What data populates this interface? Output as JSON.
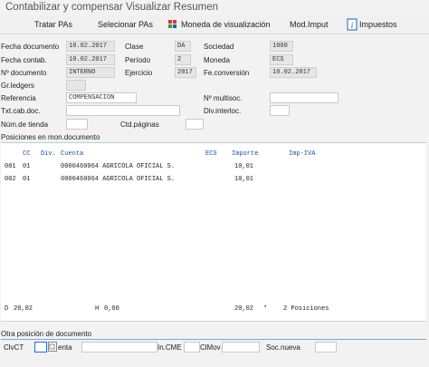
{
  "window": {
    "title": "Contabilizar y compensar Visualizar Resumen"
  },
  "toolbar": {
    "tratar": "Tratar PAs",
    "seleccionar": "Selecionar PAs",
    "moneda_vis": "Moneda de visualización",
    "mod_imput": "Mod.Imput",
    "impuestos": "Impuestos"
  },
  "header": {
    "fecha_doc_label": "Fecha documento",
    "fecha_doc": "10.02.2017",
    "clase_label": "Clase",
    "clase": "DA",
    "sociedad_label": "Sociedad",
    "sociedad": "1000",
    "fecha_contab_label": "Fecha contab.",
    "fecha_contab": "10.02.2017",
    "periodo_label": "Período",
    "periodo": "2",
    "moneda_label": "Moneda",
    "moneda": "ECS",
    "no_doc_label": "Nº documento",
    "no_doc": "INTERNO",
    "ejercicio_label": "Ejercicio",
    "ejercicio": "2017",
    "fe_conv_label": "Fe.conversión",
    "fe_conv": "10.02.2017",
    "gr_ledgers_label": "Gr.ledgers",
    "gr_ledgers": "",
    "referencia_label": "Referencia",
    "referencia": "COMPENSACION",
    "multisoc_label": "Nº multisoc.",
    "multisoc": "",
    "txt_cab_label": "Txt.cab.doc.",
    "txt_cab": "",
    "div_interloc_label": "Div.interloc.",
    "div_interloc": "",
    "num_tienda_label": "Núm.de tienda",
    "num_tienda": "",
    "ctd_paginas_label": "Ctd.páginas",
    "ctd_paginas": ""
  },
  "positions": {
    "section_title": "Posiciones en mon.documento",
    "columns": {
      "cc": "CC",
      "div": "Div.",
      "cuenta": "Cuenta",
      "ecs": "ECS",
      "importe": "Importe",
      "imp_iva": "Imp-IVA"
    },
    "rows": [
      {
        "num": "001",
        "cc": "01",
        "cuenta": "0000460064 AGRICOLA OFICIAL S.",
        "importe": "10,01"
      },
      {
        "num": "002",
        "cc": "01",
        "cuenta": "0000460064 AGRICOLA OFICIAL S.",
        "importe": "10,01"
      }
    ],
    "totals": {
      "d_label": "D",
      "d_value": "20,02",
      "h_label": "H",
      "h_value": "0,00",
      "total": "20,02",
      "star": "*",
      "positions_count": "2 Posiciones"
    }
  },
  "other_position": {
    "section_title": "Otra posición de documento",
    "clvct_label": "ClvCT",
    "clvct": "",
    "cuenta_label": "enta",
    "cuenta": "",
    "in_cme_label": "In.CME",
    "in_cme": "",
    "clmov_label": "ClMov",
    "clmov": "",
    "soc_nueva_label": "Soc.nueva",
    "soc_nueva": ""
  },
  "colors": {
    "header_blue": "#1f4fa0",
    "focus_blue": "#2d6bc2",
    "toolbar_icon_red": "#d33",
    "toolbar_icon_green": "#3a9a3a",
    "toolbar_icon_blue": "#1f5fb5"
  }
}
